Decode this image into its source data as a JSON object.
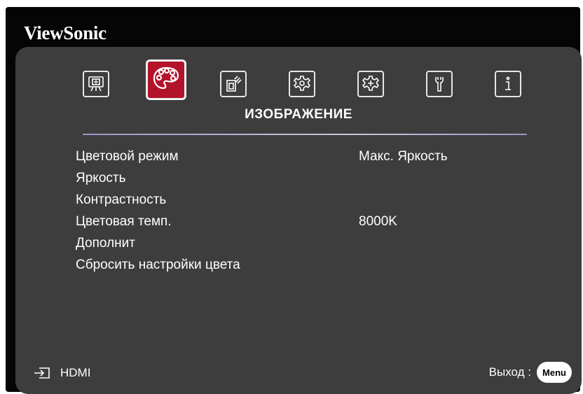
{
  "brand": "ViewSonic",
  "tabs": [
    {
      "id": "display",
      "icon": "display-icon"
    },
    {
      "id": "picture",
      "icon": "palette-icon",
      "active": true
    },
    {
      "id": "power",
      "icon": "power-management-icon"
    },
    {
      "id": "basic",
      "icon": "gear-icon"
    },
    {
      "id": "advanced",
      "icon": "advanced-gear-icon"
    },
    {
      "id": "system",
      "icon": "wrench-icon"
    },
    {
      "id": "information",
      "icon": "info-icon"
    }
  ],
  "tab_title": "ИЗОБРАЖЕНИЕ",
  "menu": {
    "items": [
      {
        "label": "Цветовой режим",
        "value": "Макс. Яркость"
      },
      {
        "label": "Яркость",
        "value": ""
      },
      {
        "label": "Контрастность",
        "value": ""
      },
      {
        "label": "Цветовая темп.",
        "value": "8000K"
      },
      {
        "label": "Дополнит",
        "value": ""
      },
      {
        "label": "Сбросить настройки цвета",
        "value": ""
      }
    ]
  },
  "footer": {
    "source_icon": "input-source-icon",
    "source": "HDMI",
    "exit_label": "Выход :",
    "menu_button": "Menu"
  },
  "colors": {
    "active_tab": "#b3122b",
    "panel": "#3d3d3d",
    "frame": "#050505",
    "divider": "#9a98c8"
  }
}
